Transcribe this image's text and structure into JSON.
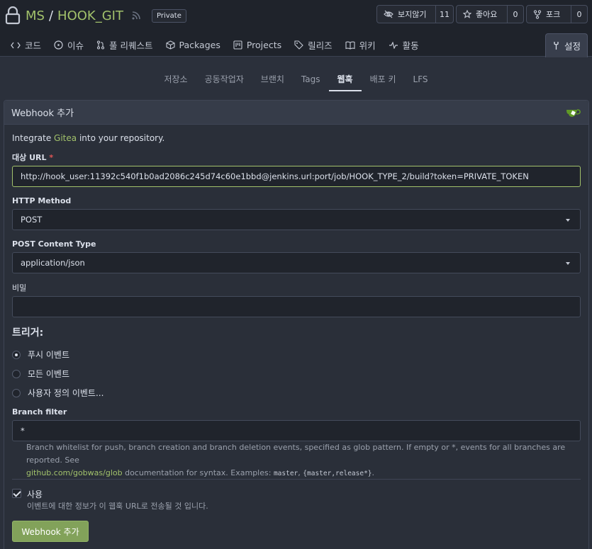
{
  "repo": {
    "owner": "MS",
    "separator": "/",
    "name": "HOOK_GIT",
    "visibility": "Private"
  },
  "actions": {
    "watch": {
      "label": "보지않기",
      "count": "11"
    },
    "star": {
      "label": "좋아요",
      "count": "0"
    },
    "fork": {
      "label": "포크",
      "count": "0"
    }
  },
  "nav": {
    "tabs": [
      {
        "label": "코드",
        "icon": "code-icon"
      },
      {
        "label": "이슈",
        "icon": "issue-icon"
      },
      {
        "label": "풀 리퀘스트",
        "icon": "pull-request-icon"
      },
      {
        "label": "Packages",
        "icon": "package-icon"
      },
      {
        "label": "Projects",
        "icon": "project-icon"
      },
      {
        "label": "릴리즈",
        "icon": "tag-icon"
      },
      {
        "label": "위키",
        "icon": "book-icon"
      },
      {
        "label": "활동",
        "icon": "pulse-icon"
      }
    ],
    "settings": "설정"
  },
  "subnav": {
    "tabs": [
      "저장소",
      "공동작업자",
      "브랜치",
      "Tags",
      "웹훅",
      "배포 키",
      "LFS"
    ],
    "active": "웹훅"
  },
  "form": {
    "header": "Webhook 추가",
    "intro_prefix": "Integrate ",
    "intro_link": "Gitea",
    "intro_suffix": " into your repository.",
    "target_url_label": "대상 URL",
    "required_mark": "*",
    "target_url_value": "http://hook_user:11392c540f1b0ad2086c245d74c60e1bbd@jenkins.url:port/job/HOOK_TYPE_2/build?token=PRIVATE_TOKEN",
    "http_method_label": "HTTP Method",
    "http_method_value": "POST",
    "content_type_label": "POST Content Type",
    "content_type_value": "application/json",
    "secret_label": "비밀",
    "secret_value": "",
    "trigger_label": "트리거:",
    "triggers": [
      {
        "label": "푸시 이벤트",
        "checked": true
      },
      {
        "label": "모든 이벤트",
        "checked": false
      },
      {
        "label": "사용자 정의 이벤트...",
        "checked": false
      }
    ],
    "branch_filter_label": "Branch filter",
    "branch_filter_value": "*",
    "branch_help_1": "Branch whitelist for push, branch creation and branch deletion events, specified as glob pattern. If empty or *, events for all branches are reported. See",
    "branch_help_link": "github.com/gobwas/glob",
    "branch_help_2": " documentation for syntax. Examples: ",
    "branch_help_code1": "master",
    "branch_help_sep": ", ",
    "branch_help_code2": "{master,release*}",
    "branch_help_end": ".",
    "active_label": "사용",
    "active_checked": true,
    "active_help": "이벤트에 대한 정보가 이 웹훅 URL로 전송될 것 입니다.",
    "submit_label": "Webhook 추가"
  },
  "colors": {
    "accent": "#a2c26b",
    "button": "#82a25a",
    "background": "#2b303b",
    "header": "#1f232b"
  }
}
